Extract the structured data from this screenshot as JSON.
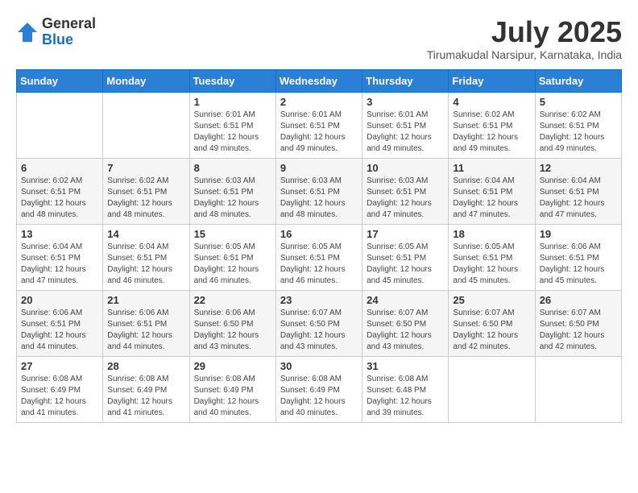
{
  "header": {
    "logo_general": "General",
    "logo_blue": "Blue",
    "month_year": "July 2025",
    "location": "Tirumakudal Narsipur, Karnataka, India"
  },
  "weekdays": [
    "Sunday",
    "Monday",
    "Tuesday",
    "Wednesday",
    "Thursday",
    "Friday",
    "Saturday"
  ],
  "weeks": [
    [
      {
        "day": "",
        "info": ""
      },
      {
        "day": "",
        "info": ""
      },
      {
        "day": "1",
        "info": "Sunrise: 6:01 AM\nSunset: 6:51 PM\nDaylight: 12 hours and 49 minutes."
      },
      {
        "day": "2",
        "info": "Sunrise: 6:01 AM\nSunset: 6:51 PM\nDaylight: 12 hours and 49 minutes."
      },
      {
        "day": "3",
        "info": "Sunrise: 6:01 AM\nSunset: 6:51 PM\nDaylight: 12 hours and 49 minutes."
      },
      {
        "day": "4",
        "info": "Sunrise: 6:02 AM\nSunset: 6:51 PM\nDaylight: 12 hours and 49 minutes."
      },
      {
        "day": "5",
        "info": "Sunrise: 6:02 AM\nSunset: 6:51 PM\nDaylight: 12 hours and 49 minutes."
      }
    ],
    [
      {
        "day": "6",
        "info": "Sunrise: 6:02 AM\nSunset: 6:51 PM\nDaylight: 12 hours and 48 minutes."
      },
      {
        "day": "7",
        "info": "Sunrise: 6:02 AM\nSunset: 6:51 PM\nDaylight: 12 hours and 48 minutes."
      },
      {
        "day": "8",
        "info": "Sunrise: 6:03 AM\nSunset: 6:51 PM\nDaylight: 12 hours and 48 minutes."
      },
      {
        "day": "9",
        "info": "Sunrise: 6:03 AM\nSunset: 6:51 PM\nDaylight: 12 hours and 48 minutes."
      },
      {
        "day": "10",
        "info": "Sunrise: 6:03 AM\nSunset: 6:51 PM\nDaylight: 12 hours and 47 minutes."
      },
      {
        "day": "11",
        "info": "Sunrise: 6:04 AM\nSunset: 6:51 PM\nDaylight: 12 hours and 47 minutes."
      },
      {
        "day": "12",
        "info": "Sunrise: 6:04 AM\nSunset: 6:51 PM\nDaylight: 12 hours and 47 minutes."
      }
    ],
    [
      {
        "day": "13",
        "info": "Sunrise: 6:04 AM\nSunset: 6:51 PM\nDaylight: 12 hours and 47 minutes."
      },
      {
        "day": "14",
        "info": "Sunrise: 6:04 AM\nSunset: 6:51 PM\nDaylight: 12 hours and 46 minutes."
      },
      {
        "day": "15",
        "info": "Sunrise: 6:05 AM\nSunset: 6:51 PM\nDaylight: 12 hours and 46 minutes."
      },
      {
        "day": "16",
        "info": "Sunrise: 6:05 AM\nSunset: 6:51 PM\nDaylight: 12 hours and 46 minutes."
      },
      {
        "day": "17",
        "info": "Sunrise: 6:05 AM\nSunset: 6:51 PM\nDaylight: 12 hours and 45 minutes."
      },
      {
        "day": "18",
        "info": "Sunrise: 6:05 AM\nSunset: 6:51 PM\nDaylight: 12 hours and 45 minutes."
      },
      {
        "day": "19",
        "info": "Sunrise: 6:06 AM\nSunset: 6:51 PM\nDaylight: 12 hours and 45 minutes."
      }
    ],
    [
      {
        "day": "20",
        "info": "Sunrise: 6:06 AM\nSunset: 6:51 PM\nDaylight: 12 hours and 44 minutes."
      },
      {
        "day": "21",
        "info": "Sunrise: 6:06 AM\nSunset: 6:51 PM\nDaylight: 12 hours and 44 minutes."
      },
      {
        "day": "22",
        "info": "Sunrise: 6:06 AM\nSunset: 6:50 PM\nDaylight: 12 hours and 43 minutes."
      },
      {
        "day": "23",
        "info": "Sunrise: 6:07 AM\nSunset: 6:50 PM\nDaylight: 12 hours and 43 minutes."
      },
      {
        "day": "24",
        "info": "Sunrise: 6:07 AM\nSunset: 6:50 PM\nDaylight: 12 hours and 43 minutes."
      },
      {
        "day": "25",
        "info": "Sunrise: 6:07 AM\nSunset: 6:50 PM\nDaylight: 12 hours and 42 minutes."
      },
      {
        "day": "26",
        "info": "Sunrise: 6:07 AM\nSunset: 6:50 PM\nDaylight: 12 hours and 42 minutes."
      }
    ],
    [
      {
        "day": "27",
        "info": "Sunrise: 6:08 AM\nSunset: 6:49 PM\nDaylight: 12 hours and 41 minutes."
      },
      {
        "day": "28",
        "info": "Sunrise: 6:08 AM\nSunset: 6:49 PM\nDaylight: 12 hours and 41 minutes."
      },
      {
        "day": "29",
        "info": "Sunrise: 6:08 AM\nSunset: 6:49 PM\nDaylight: 12 hours and 40 minutes."
      },
      {
        "day": "30",
        "info": "Sunrise: 6:08 AM\nSunset: 6:49 PM\nDaylight: 12 hours and 40 minutes."
      },
      {
        "day": "31",
        "info": "Sunrise: 6:08 AM\nSunset: 6:48 PM\nDaylight: 12 hours and 39 minutes."
      },
      {
        "day": "",
        "info": ""
      },
      {
        "day": "",
        "info": ""
      }
    ]
  ]
}
